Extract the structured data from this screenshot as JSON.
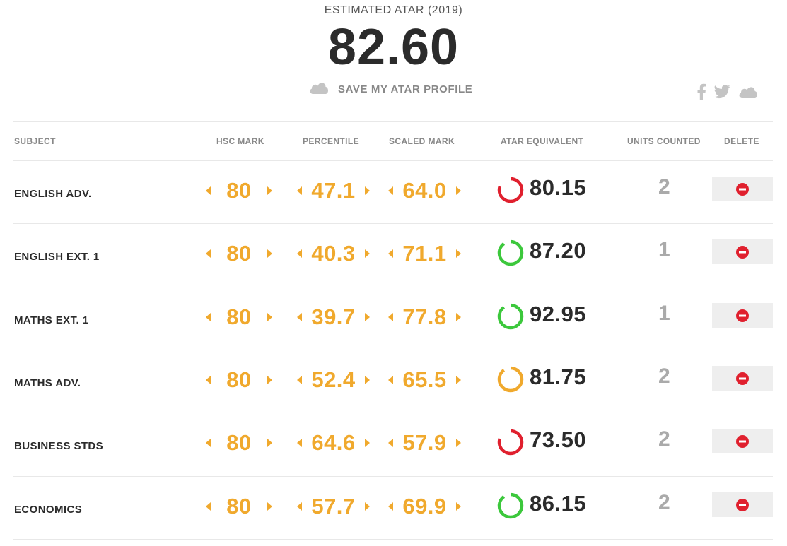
{
  "header": {
    "estimate_label": "ESTIMATED ATAR (2019)",
    "atar": "82.60",
    "save_label": "SAVE MY ATAR PROFILE",
    "save_icon": "cloud-icon",
    "social_icons": [
      "facebook-icon",
      "twitter-icon",
      "cloud-icon"
    ]
  },
  "columns": {
    "subject": "SUBJECT",
    "hsc": "HSC MARK",
    "percentile": "PERCENTILE",
    "scaled": "SCALED MARK",
    "atar_eq": "ATAR EQUIVALENT",
    "units": "UNITS COUNTED",
    "delete": "DELETE"
  },
  "colors": {
    "accent": "#f0a92d",
    "ring_red": "#e0202e",
    "ring_green": "#3cc83c",
    "ring_orange": "#f0a92d",
    "delete_red": "#e0202e"
  },
  "rows": [
    {
      "subject": "ENGLISH ADV.",
      "hsc": "80",
      "percentile": "47.1",
      "scaled": "64.0",
      "atar_eq": "80.15",
      "units": "2",
      "ring": "red",
      "ring_fill": 0.8
    },
    {
      "subject": "ENGLISH EXT. 1",
      "hsc": "80",
      "percentile": "40.3",
      "scaled": "71.1",
      "atar_eq": "87.20",
      "units": "1",
      "ring": "green",
      "ring_fill": 0.9
    },
    {
      "subject": "MATHS EXT. 1",
      "hsc": "80",
      "percentile": "39.7",
      "scaled": "77.8",
      "atar_eq": "92.95",
      "units": "1",
      "ring": "green",
      "ring_fill": 0.9
    },
    {
      "subject": "MATHS ADV.",
      "hsc": "80",
      "percentile": "52.4",
      "scaled": "65.5",
      "atar_eq": "81.75",
      "units": "2",
      "ring": "orange",
      "ring_fill": 0.9
    },
    {
      "subject": "BUSINESS STDS",
      "hsc": "80",
      "percentile": "64.6",
      "scaled": "57.9",
      "atar_eq": "73.50",
      "units": "2",
      "ring": "red",
      "ring_fill": 0.8
    },
    {
      "subject": "ECONOMICS",
      "hsc": "80",
      "percentile": "57.7",
      "scaled": "69.9",
      "atar_eq": "86.15",
      "units": "2",
      "ring": "green",
      "ring_fill": 0.9
    }
  ]
}
